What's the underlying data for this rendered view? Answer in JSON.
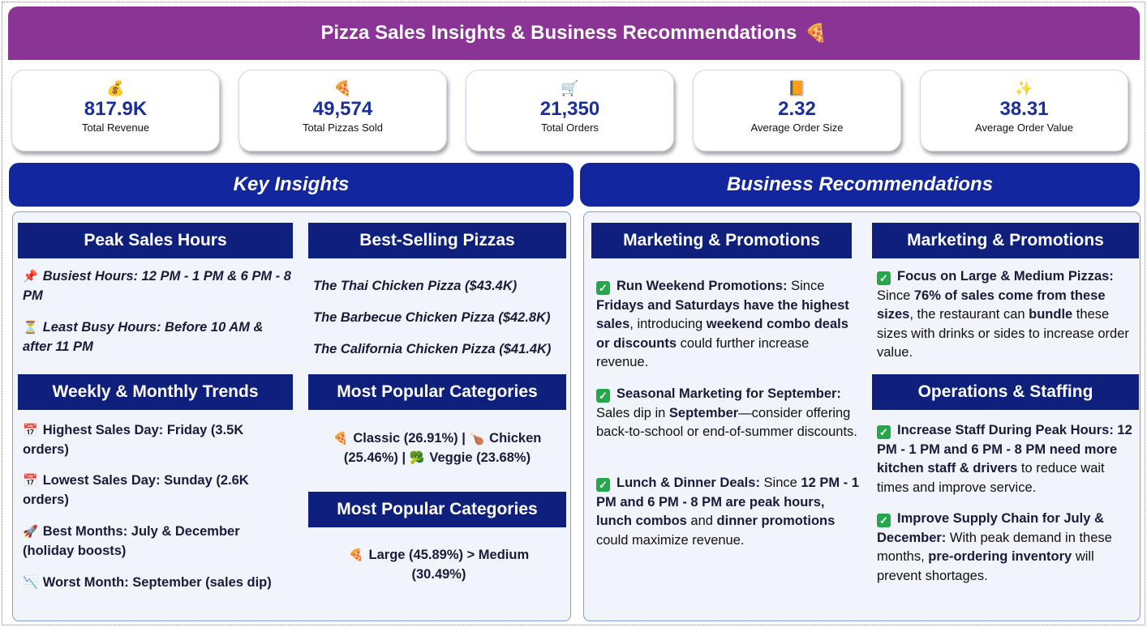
{
  "header": {
    "title": "Pizza Sales Insights & Business Recommendations",
    "title_icon": "🍕"
  },
  "kpis": [
    {
      "icon": "💰",
      "icon_name": "money-bag-icon",
      "value": "817.9K",
      "label": "Total Revenue"
    },
    {
      "icon": "🍕",
      "icon_name": "pizza-icon",
      "value": "49,574",
      "label": "Total Pizzas Sold"
    },
    {
      "icon": "🛒",
      "icon_name": "cart-icon",
      "value": "21,350",
      "label": "Total Orders"
    },
    {
      "icon": "📙",
      "icon_name": "receipt-icon",
      "value": "2.32",
      "label": "Average Order Size"
    },
    {
      "icon": "✨",
      "icon_name": "sparkles-icon",
      "value": "38.31",
      "label": "Average Order Value"
    }
  ],
  "insights": {
    "heading": "Key Insights",
    "peak": {
      "heading": "Peak Sales Hours",
      "items": [
        {
          "icon": "📌",
          "text": "Busiest Hours: 12 PM - 1 PM & 6 PM - 8 PM"
        },
        {
          "icon": "⏳",
          "text": "Least Busy Hours: Before 10 AM & after 11 PM"
        }
      ]
    },
    "trends": {
      "heading": "Weekly & Monthly Trends",
      "items": [
        {
          "icon": "📅",
          "text": "Highest Sales Day: Friday (3.5K orders)"
        },
        {
          "icon": "📅",
          "text": "Lowest Sales Day: Sunday (2.6K orders)"
        },
        {
          "icon": "🚀",
          "text": "Best Months: July & December (holiday boosts)"
        },
        {
          "icon": "📉",
          "text": "Worst Month: September (sales dip)"
        }
      ]
    },
    "best_selling": {
      "heading": "Best-Selling Pizzas",
      "items": [
        "The Thai Chicken Pizza ($43.4K)",
        "The Barbecue Chicken Pizza ($42.8K)",
        "The California Chicken Pizza ($41.4K)"
      ]
    },
    "categories": {
      "heading": "Most Popular Categories",
      "icons": [
        "🍕",
        "🍗",
        "🥦"
      ],
      "classic": "Classic (26.91%) |",
      "chicken": "Chicken (25.46%) |",
      "veggie": "Veggie (23.68%)"
    },
    "sizes": {
      "heading": "Most Popular Categories",
      "icon": "🍕",
      "text": "Large (45.89%) > Medium (30.49%)"
    }
  },
  "recommendations": {
    "heading": "Business Recommendations",
    "marketing_left": {
      "heading": "Marketing & Promotions",
      "item1": {
        "bold_a": "Run Weekend Promotions:",
        "text_a": " Since ",
        "bold_b": "Fridays and Saturdays have the highest sales",
        "text_b": ", introducing ",
        "bold_c": "weekend combo deals or discounts",
        "text_c": " could further increase revenue."
      },
      "item2": {
        "bold_a": "Seasonal Marketing for September:",
        "text_a": " Sales dip in ",
        "bold_b": "September",
        "text_b": "—consider offering back-to-school or end-of-summer discounts."
      },
      "item3": {
        "bold_a": "Lunch & Dinner Deals:",
        "text_a": " Since ",
        "bold_b": "12 PM - 1 PM and 6 PM - 8 PM are peak hours, lunch combos",
        "text_b": " and ",
        "bold_c": "dinner promotions",
        "text_c": " could maximize revenue."
      }
    },
    "marketing_right": {
      "heading": "Marketing & Promotions",
      "item1": {
        "bold_a": "Focus on Large & Medium Pizzas:",
        "text_a": " Since ",
        "bold_b": "76% of sales come from these sizes",
        "text_b": ", the restaurant can ",
        "bold_c": "bundle",
        "text_c": " these sizes with drinks or sides to increase order value."
      }
    },
    "operations": {
      "heading": "Operations & Staffing",
      "item1": {
        "bold_a": "Increase Staff During Peak Hours: 12 PM - 1 PM and 6 PM - 8 PM need more kitchen staff & drivers",
        "text_a": " to reduce wait times and improve service."
      },
      "item2": {
        "bold_a": "Improve Supply Chain for July & December:",
        "text_a": " With peak demand in these months, ",
        "bold_b": "pre-ordering inventory",
        "text_b": " will prevent shortages."
      }
    },
    "check_icon": "✓"
  }
}
